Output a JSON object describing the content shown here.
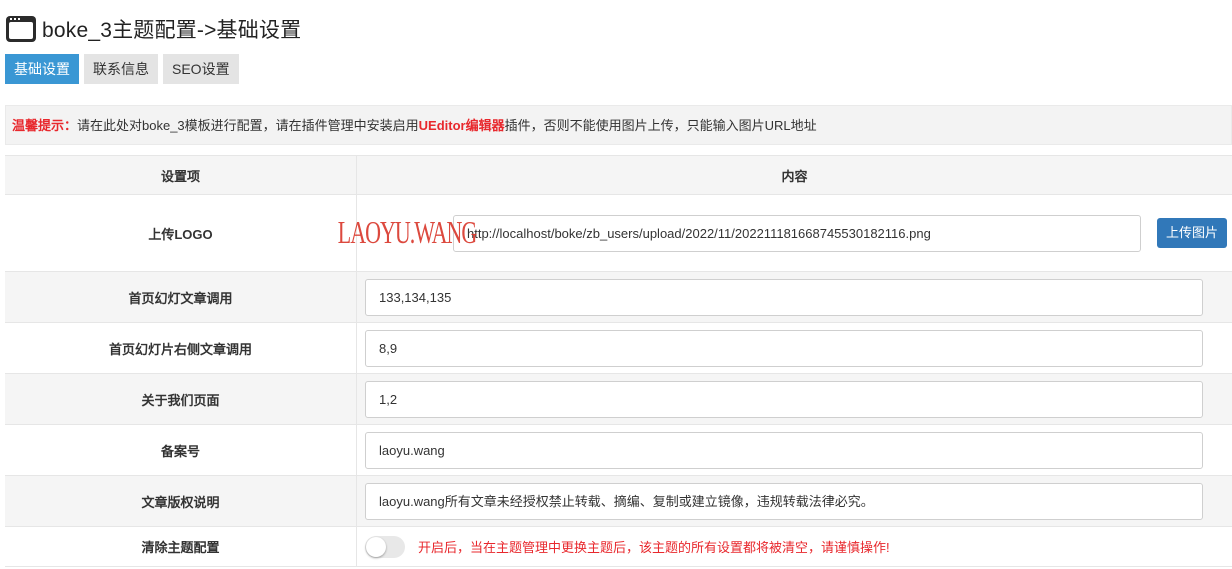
{
  "header": {
    "title": "boke_3主题配置->基础设置"
  },
  "tabs": [
    {
      "label": "基础设置",
      "active": true
    },
    {
      "label": "联系信息",
      "active": false
    },
    {
      "label": "SEO设置",
      "active": false
    }
  ],
  "notice": {
    "prefix": "温馨提示：",
    "text_before": "请在此处对boke_3模板进行配置，请在插件管理中安装启用",
    "highlight": "UEditor编辑器",
    "text_after": "插件，否则不能使用图片上传，只能输入图片URL地址"
  },
  "table": {
    "col_setting": "设置项",
    "col_content": "内容"
  },
  "logo": {
    "label": "上传LOGO",
    "logo_text": "LAOYU.WANG",
    "url": "http://localhost/boke/zb_users/upload/2022/11/202211181668745530182116.png",
    "upload_label": "上传图片"
  },
  "settings": [
    {
      "label": "首页幻灯文章调用",
      "value": "133,134,135"
    },
    {
      "label": "首页幻灯片右侧文章调用",
      "value": "8,9"
    },
    {
      "label": "关于我们页面",
      "value": "1,2"
    },
    {
      "label": "备案号",
      "value": "laoyu.wang"
    },
    {
      "label": "文章版权说明",
      "value": "laoyu.wang所有文章未经授权禁止转载、摘编、复制或建立镜像，违规转载法律必究。"
    }
  ],
  "clear": {
    "label": "清除主题配置",
    "enabled": false,
    "warning": "开启后，当在主题管理中更换主题后，该主题的所有设置都将被清空，请谨慎操作!"
  },
  "colors": {
    "accent": "#3a97d4",
    "button": "#3178b9",
    "warning": "#e8282d"
  }
}
